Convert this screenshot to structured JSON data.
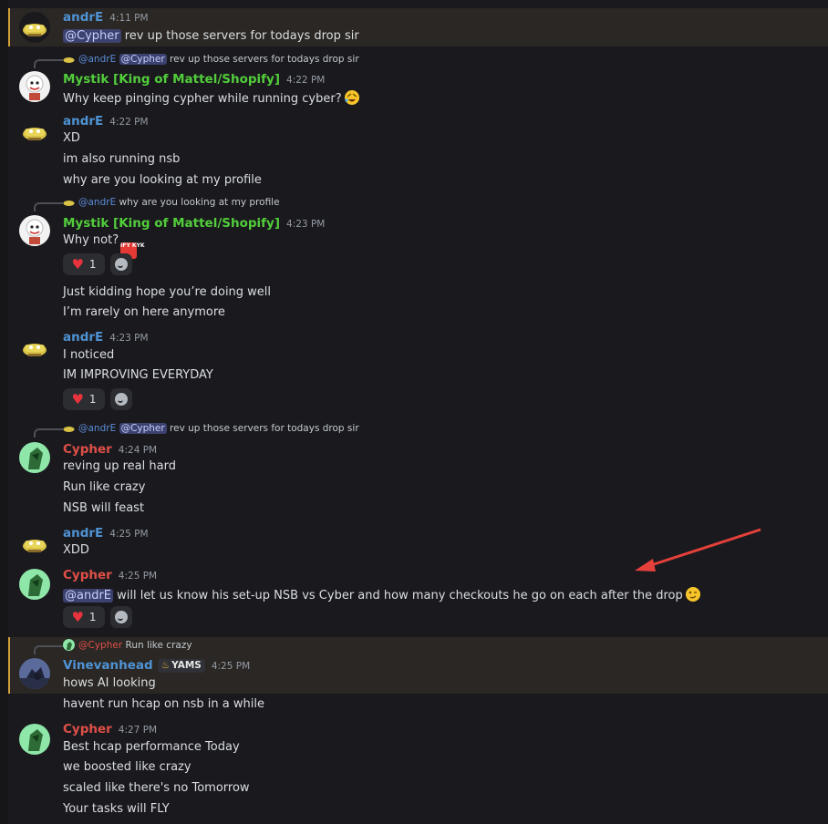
{
  "users": {
    "andre": {
      "name": "andrE",
      "color": "#4f93d4"
    },
    "mystik": {
      "name": "Mystik [King of Mattel/Shopify]",
      "color": "#52cd3a"
    },
    "cypher": {
      "name": "Cypher",
      "color": "#e04f47"
    },
    "vine": {
      "name": "Vinevanhead",
      "color": "#4f93d4"
    }
  },
  "messages": [
    {
      "author": "andrE",
      "time": "4:11 PM",
      "mention": "@Cypher",
      "text": " rev up those servers for todays drop sir"
    },
    {
      "reply_to": "@andrE",
      "reply_mention": "@Cypher",
      "reply_text": " rev up those servers for todays drop sir",
      "author": "Mystik [King of Mattel/Shopify]",
      "time": "4:22 PM",
      "text": "Why keep pinging cypher while running cyber?"
    },
    {
      "author": "andrE",
      "time": "4:22 PM",
      "lines": [
        "XD",
        "im also running nsb",
        "why are you looking at my profile"
      ]
    },
    {
      "reply_to": "@andrE",
      "reply_text": " why are you looking at my profile",
      "author": "Mystik [King of Mattel/Shopify]",
      "time": "4:23 PM",
      "text": "Why not?",
      "reaction_count": "1",
      "lines": [
        "Just kidding hope you’re doing well",
        "I’m rarely on here anymore"
      ]
    },
    {
      "author": "andrE",
      "time": "4:23 PM",
      "lines": [
        "I noticed",
        "IM IMPROVING EVERYDAY"
      ],
      "reaction_count": "1"
    },
    {
      "reply_to": "@andrE",
      "reply_mention": "@Cypher",
      "reply_text": " rev up those servers for todays drop sir",
      "author": "Cypher",
      "time": "4:24 PM",
      "lines": [
        "reving up real hard",
        "Run like crazy",
        "NSB will feast"
      ]
    },
    {
      "author": "andrE",
      "time": "4:25 PM",
      "text": "XDD"
    },
    {
      "author": "Cypher",
      "time": "4:25 PM",
      "mention": "@andrE",
      "text": " will let us know his set-up NSB vs Cyber and how many checkouts he go on each after the drop",
      "reaction_count": "1"
    },
    {
      "reply_to": "@Cypher",
      "reply_text": " Run like crazy",
      "author": "Vinevanhead",
      "badge": "YAMS",
      "time": "4:25 PM",
      "lines": [
        "hows AI looking",
        "havent run hcap on nsb in a while"
      ]
    },
    {
      "author": "Cypher",
      "time": "4:27 PM",
      "lines": [
        "Best hcap performance Today",
        "we boosted like crazy",
        "scaled like there's no Tomorrow",
        "Your tasks will FLY"
      ]
    }
  ],
  "emoji": {
    "rofl": "rolling-on-floor-laughing",
    "ifykyk": "IFY KYK",
    "wink": "winking-face",
    "heart": "red-heart",
    "add_reaction": "add-reaction-icon"
  },
  "accent": {
    "highlight_bar": "#d4a13a",
    "arrow": "#e5403a",
    "background": "#1a1a1e"
  }
}
